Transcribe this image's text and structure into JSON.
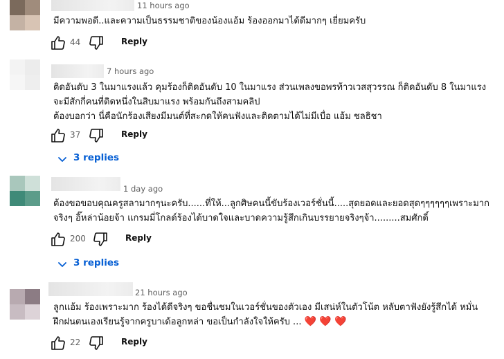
{
  "comments": [
    {
      "time": "11 hours ago",
      "lines": [
        "มีความพอดี..และความเป็นธรรมชาติของน้องแอ้ม  ร้องออกมาได้ดีมากๆ  เยี่ยมครับ"
      ],
      "likes": "44",
      "reply_label": "Reply",
      "avatar_colors": [
        "#7b6a5c",
        "#a08c7c",
        "#c4b2a4",
        "#d8c4b4"
      ]
    },
    {
      "time": "7 hours ago",
      "lines": [
        "ติดอันดับ 3 ในมาแรงแล้ว คุมร้องก็ติดอันดับ 10 ในมาแรง  ส่วนเพลงขอพรท้าวเวสสุวรรณ ก็ติดอันดับ 8 ในมาแรง",
        "จะมีสักกี่คนที่ติดหนึ่งในสิบมาแรง พร้อมกันถึงสามคลิป",
        "ต้องบอกว่า นี่คือนักร้องเสียงมีมนต์ที่สะกดให้คนฟังและติดตามได้ไม่มีเบื่อ แอ้ม ชลธิชา"
      ],
      "likes": "37",
      "reply_label": "Reply",
      "replies_label": "3 replies",
      "avatar_colors": [
        "#f3f3f3",
        "#ececec",
        "#f6f6f6",
        "#eeeeee"
      ]
    },
    {
      "time": "1 day ago",
      "lines": [
        "ต้องขอขอบคุณครูสลามากๆนะครับ......ที่ให้...ลูกศิษคนนี้ขับร้องเวอร์ชั่นนี้.....สุดยอดและยอดสุดๆๆๆๆๆๆเพราะมาก",
        "จริงๆ อิ๊หล่าน้อยจ้า แกรมมี่โกลด์ร้องได้บาดใจและบาดความรู้สึกเกินบรรยายจริงๆจ้า.........สมศักดิ์"
      ],
      "likes": "200",
      "reply_label": "Reply",
      "replies_label": "3 replies",
      "avatar_colors": [
        "#a9c7bc",
        "#cfe0d9",
        "#3f8a78",
        "#5c9c8a"
      ]
    },
    {
      "time": "21 hours ago",
      "lines": [
        "ลูกแอ้ม ร้องเพราะมาก ร้องได้ดีจริงๆ ขอชื่นชมในเวอร์ชั่นของตัวเอง มีเสน่ห์ในตัวโน้ต หลับตาฟังยังรู้สึกได้  หมั่น",
        "ฝึกฝนตนเองเรียนรู้จากครูบาเด้อลูกหล่า ขอเป็นกำลังใจให้ครับ ..."
      ],
      "hearts": "❤️ ❤️ ❤️",
      "likes": "22",
      "reply_label": "Reply",
      "avatar_colors": [
        "#b8aab0",
        "#8c7c84",
        "#c8bcc2",
        "#ddd3d8"
      ]
    }
  ]
}
